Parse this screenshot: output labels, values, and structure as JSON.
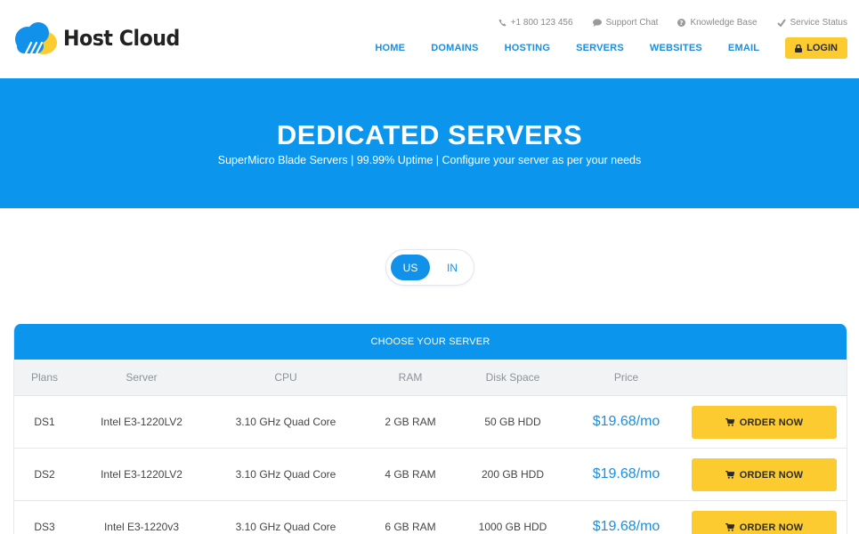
{
  "brand": {
    "name": "Host Cloud"
  },
  "topbar": {
    "phone": "+1 800 123 456",
    "chat": "Support Chat",
    "kb": "Knowledge Base",
    "status": "Service Status"
  },
  "nav": {
    "items": [
      "HOME",
      "DOMAINS",
      "HOSTING",
      "SERVERS",
      "WEBSITES",
      "EMAIL"
    ],
    "login": "LOGIN"
  },
  "hero": {
    "title": "DEDICATED SERVERS",
    "subtitle": "SuperMicro Blade Servers | 99.99% Uptime | Configure your server as per your needs"
  },
  "region_toggle": {
    "options": [
      "US",
      "IN"
    ],
    "selected": "US"
  },
  "table": {
    "title": "CHOOSE YOUR SERVER",
    "columns": [
      "Plans",
      "Server",
      "CPU",
      "RAM",
      "Disk Space",
      "Price"
    ],
    "order_label": "ORDER NOW",
    "rows": [
      {
        "plan": "DS1",
        "server": "Intel E3-1220LV2",
        "cpu": "3.10 GHz Quad Core",
        "ram": "2 GB RAM",
        "disk": "50 GB HDD",
        "price": "$19.68/mo"
      },
      {
        "plan": "DS2",
        "server": "Intel E3-1220LV2",
        "cpu": "3.10 GHz Quad Core",
        "ram": "4 GB RAM",
        "disk": "200 GB HDD",
        "price": "$19.68/mo"
      },
      {
        "plan": "DS3",
        "server": "Intel E3-1220v3",
        "cpu": "3.10 GHz Quad Core",
        "ram": "6 GB RAM",
        "disk": "1000 GB HDD",
        "price": "$19.68/mo"
      }
    ]
  },
  "colors": {
    "primary": "#0c95ec",
    "accent": "#fccb2f",
    "link": "#1a8fe0"
  }
}
